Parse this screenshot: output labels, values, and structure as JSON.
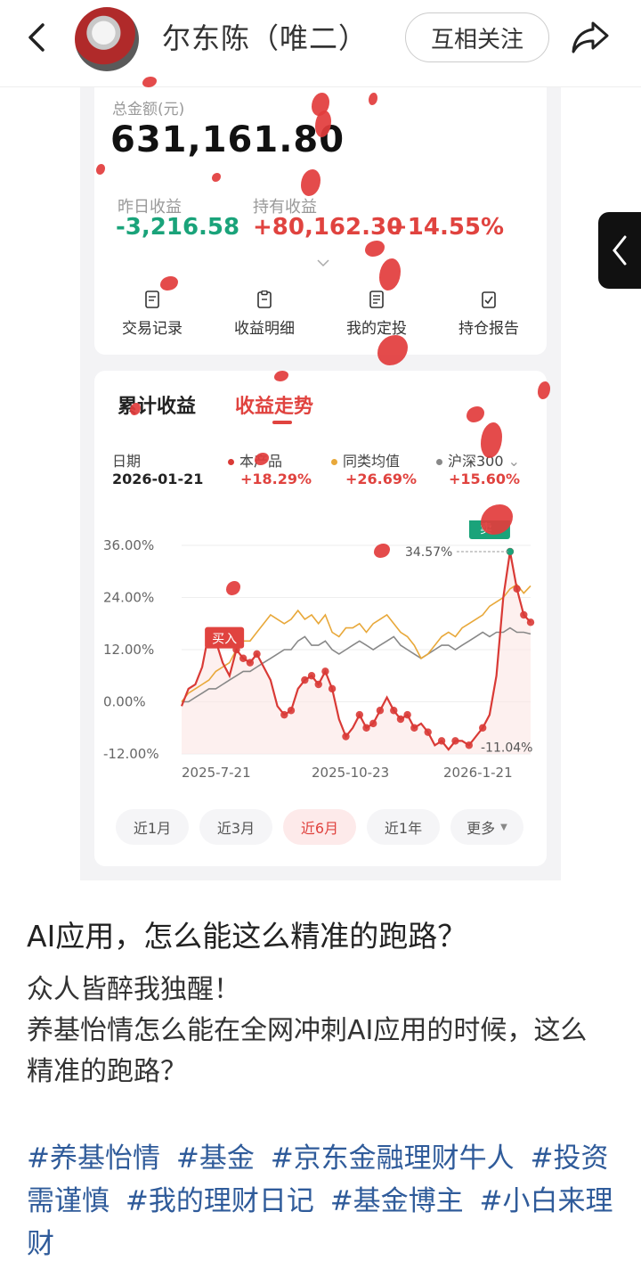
{
  "header": {
    "username": "尔东陈（唯二）",
    "follow_label": "互相关注"
  },
  "account": {
    "total_label": "总金额(元)",
    "total_value": "631,161.80",
    "yesterday_label": "昨日收益",
    "yesterday_value": "-3,216.58",
    "holding_label": "持有收益",
    "holding_value": "+80,162.30",
    "holding_rate": "+14.55%"
  },
  "menu": [
    {
      "label": "交易记录",
      "icon": "receipt-icon"
    },
    {
      "label": "收益明细",
      "icon": "clipboard-icon"
    },
    {
      "label": "我的定投",
      "icon": "document-icon"
    },
    {
      "label": "持仓报告",
      "icon": "checklist-icon"
    }
  ],
  "tabs": {
    "cumulative": "累计收益",
    "trend": "收益走势"
  },
  "legend": {
    "date_label": "日期",
    "date_value": "2026-01-21",
    "series": [
      {
        "name": "本产品",
        "value": "+18.29%",
        "color": "#d93a36"
      },
      {
        "name": "同类均值",
        "value": "+26.69%",
        "color": "#e8a83a"
      },
      {
        "name": "沪深300",
        "value": "+15.60%",
        "color": "#888888"
      }
    ]
  },
  "chart_data": {
    "type": "line",
    "y_ticks": [
      "36.00%",
      "24.00%",
      "12.00%",
      "0.00%",
      "-12.00%"
    ],
    "ylim": [
      -12,
      36
    ],
    "x_ticks": [
      "2025-7-21",
      "2025-10-23",
      "2026-1-21"
    ],
    "annotations": {
      "buy_label": "买入",
      "sell_label": "卖",
      "max_label": "34.57%",
      "min_label": "-11.04%"
    },
    "series": [
      {
        "name": "本产品",
        "color": "#d93a36",
        "values": [
          -1,
          3,
          4,
          8,
          16,
          14,
          9,
          6,
          12,
          10,
          9,
          11,
          8,
          5,
          -1,
          -3,
          -2,
          3,
          5,
          6,
          4,
          7,
          3,
          -4,
          -8,
          -6,
          -3,
          -6,
          -5,
          -2,
          1,
          -2,
          -4,
          -3,
          -6,
          -5,
          -7,
          -10,
          -9,
          -11,
          -9,
          -9,
          -10,
          -8,
          -6,
          -3,
          6,
          24,
          34.57,
          26,
          20,
          18.29
        ]
      },
      {
        "name": "同类均值",
        "color": "#e8a83a",
        "values": [
          0,
          2,
          3,
          4,
          5,
          7,
          8,
          9,
          12,
          14,
          14,
          16,
          18,
          20,
          19,
          18,
          19,
          21,
          19,
          20,
          18,
          20,
          16,
          15,
          17,
          17,
          18,
          16,
          18,
          19,
          20,
          18,
          16,
          15,
          13,
          10,
          11,
          13,
          15,
          16,
          15,
          17,
          18,
          19,
          20,
          22,
          23,
          24,
          26,
          27,
          25,
          26.69
        ]
      },
      {
        "name": "沪深300",
        "color": "#888888",
        "values": [
          0,
          0,
          1,
          2,
          3,
          3,
          4,
          5,
          6,
          7,
          7,
          8,
          9,
          10,
          11,
          12,
          12,
          14,
          15,
          13,
          13,
          14,
          12,
          11,
          12,
          13,
          14,
          13,
          12,
          13,
          14,
          15,
          13,
          12,
          11,
          10,
          11,
          12,
          13,
          13,
          12,
          13,
          14,
          15,
          16,
          15,
          16,
          16,
          17,
          16,
          16,
          15.6
        ]
      }
    ]
  },
  "ranges": [
    "近1月",
    "近3月",
    "近6月",
    "近1年",
    "更多"
  ],
  "post": {
    "title": "AI应用，怎么能这么精准的跑路？",
    "body_line1": "众人皆醉我独醒！",
    "body_line2": "养基怡情怎么能在全网冲刺AI应用的时候，这么精准的跑路？",
    "tags": [
      "#养基怡情",
      "#基金",
      "#京东金融理财牛人",
      "#投资需谨慎",
      "#我的理财日记",
      "#基金博主",
      "#小白来理财"
    ]
  }
}
